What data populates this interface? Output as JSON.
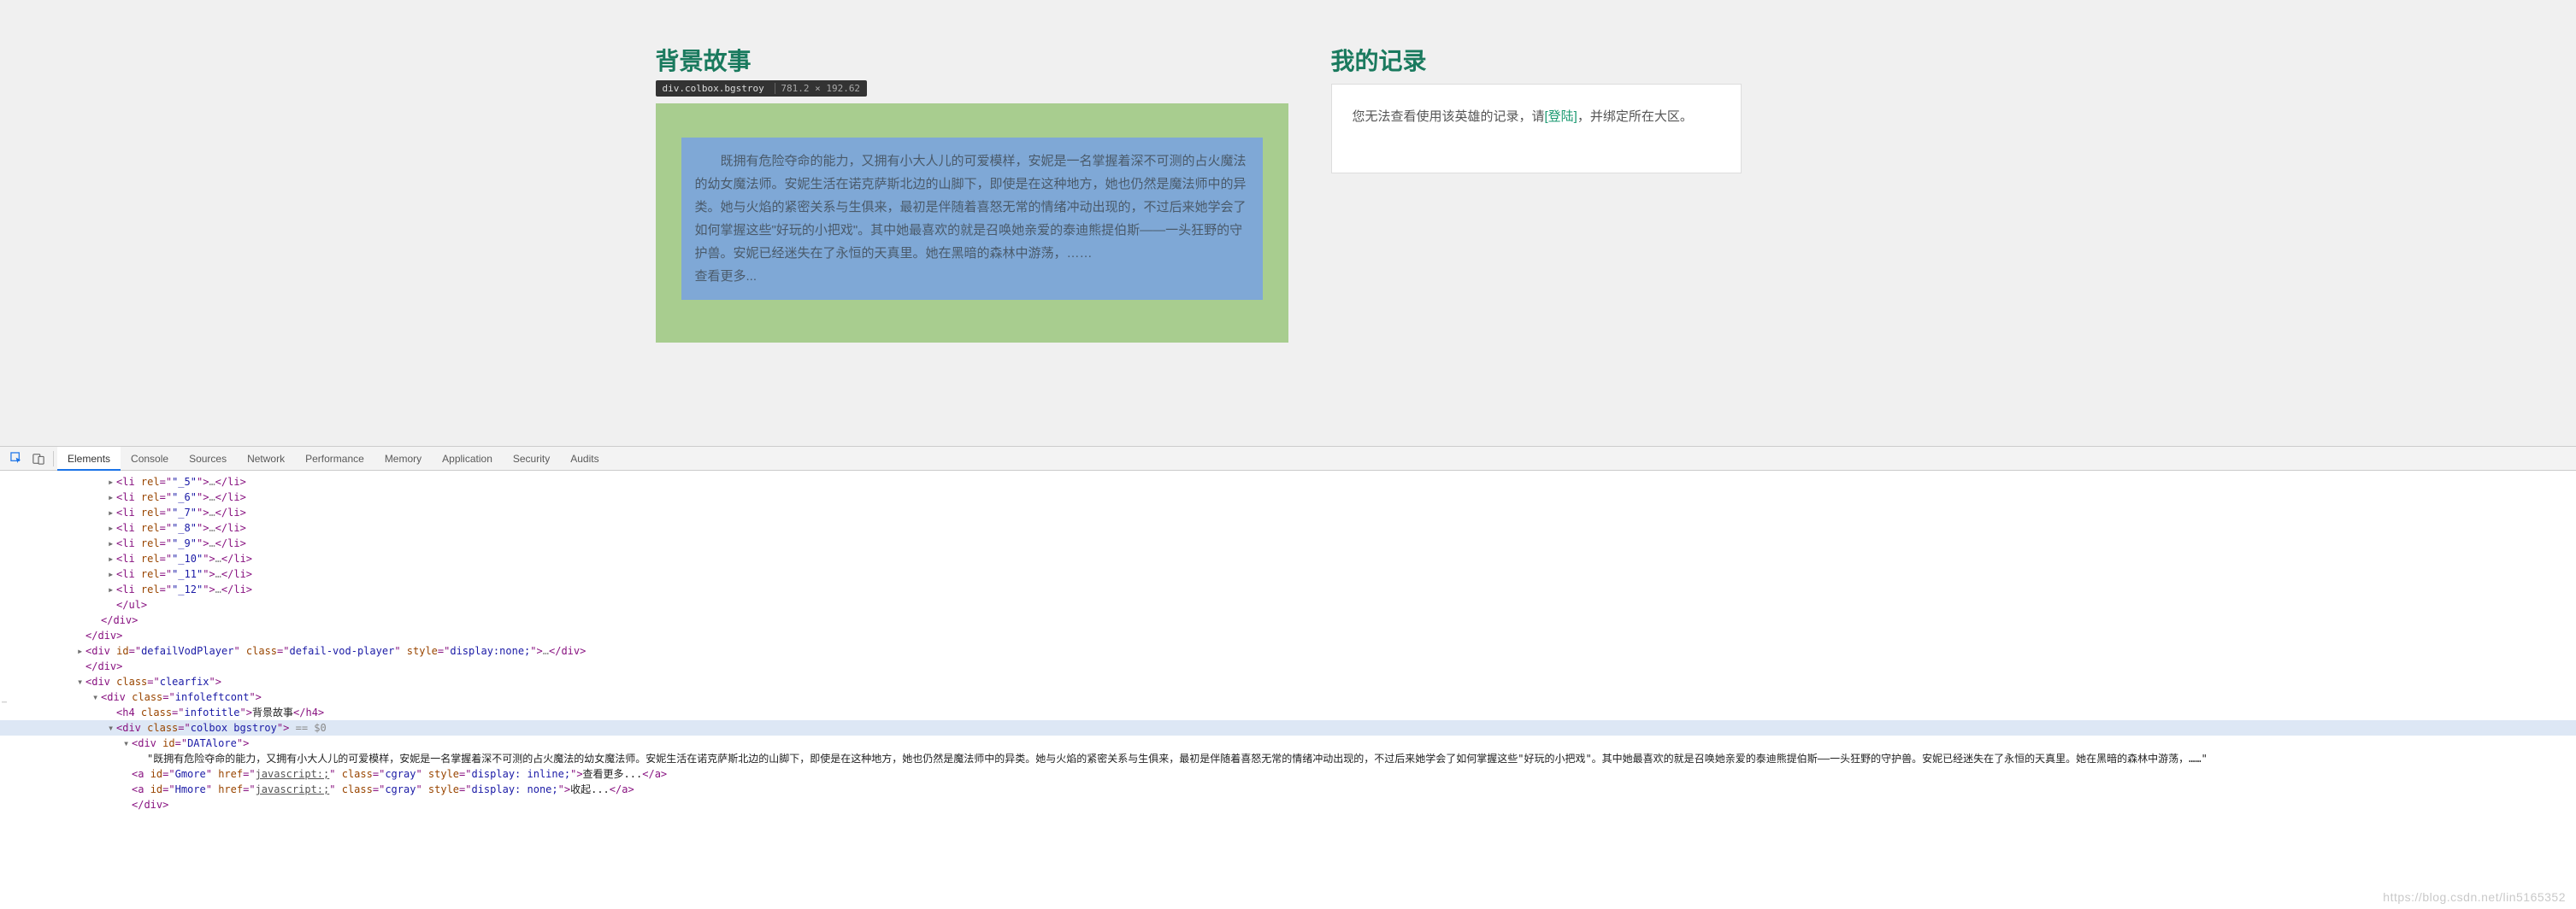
{
  "page": {
    "bgstory": {
      "title": "背景故事",
      "tooltip_selector": "div.colbox.bgstroy",
      "tooltip_dims": "781.2 × 192.62",
      "lore_text": "既拥有危险夺命的能力，又拥有小大人儿的可爱模样，安妮是一名掌握着深不可测的占火魔法的幼女魔法师。安妮生活在诺克萨斯北边的山脚下，即使是在这种地方，她也仍然是魔法师中的异类。她与火焰的紧密关系与生俱来，最初是伴随着喜怒无常的情绪冲动出现的，不过后来她学会了如何掌握这些\"好玩的小把戏\"。其中她最喜欢的就是召唤她亲爱的泰迪熊提伯斯——一头狂野的守护兽。安妮已经迷失在了永恒的天真里。她在黑暗的森林中游荡，……",
      "more_label": "查看更多..."
    },
    "record": {
      "title": "我的记录",
      "text_before": "您无法查看使用该英雄的记录，请",
      "login_label": "[登陆]",
      "text_after": "，并绑定所在大区。"
    }
  },
  "devtools": {
    "tabs": [
      "Elements",
      "Console",
      "Sources",
      "Network",
      "Performance",
      "Memory",
      "Application",
      "Security",
      "Audits"
    ],
    "active_tab": "Elements",
    "li_rels": [
      "_5",
      "_6",
      "_7",
      "_8",
      "_9",
      "_10",
      "_11",
      "_12"
    ],
    "lines": {
      "ul_close": "</ul>",
      "div_close": "</div>",
      "defailVod": {
        "id": "defailVodPlayer",
        "class": "defail-vod-player",
        "style": "display:none;",
        "inner": "…"
      },
      "clearfix_class": "clearfix",
      "infoleftcont_class": "infoleftcont",
      "h4_class": "infotitle",
      "h4_text": "背景故事",
      "colbox_class": "colbox bgstroy",
      "sel_marker": "== $0",
      "dataAlore_id": "DATAlore",
      "lore_quote": "\"既拥有危险夺命的能力，又拥有小大人儿的可爱模样，安妮是一名掌握着深不可测的占火魔法的幼女魔法师。安妮生活在诺克萨斯北边的山脚下，即使是在这种地方，她也仍然是魔法师中的异类。她与火焰的紧密关系与生俱来，最初是伴随着喜怒无常的情绪冲动出现的，不过后来她学会了如何掌握这些\"好玩的小把戏\"。其中她最喜欢的就是召唤她亲爱的泰迪熊提伯斯——一头狂野的守护兽。安妮已经迷失在了永恒的天真里。她在黑暗的森林中游荡，……\"",
      "gmore_id": "Gmore",
      "hmore_id": "Hmore",
      "js_href": "javascript:;",
      "cgray_class": "cgray",
      "style_inline": "display: inline;",
      "style_none": "display: none;",
      "gmore_text": "查看更多...",
      "hmore_text": "收起..."
    }
  },
  "watermark": "https://blog.csdn.net/lin5165352"
}
